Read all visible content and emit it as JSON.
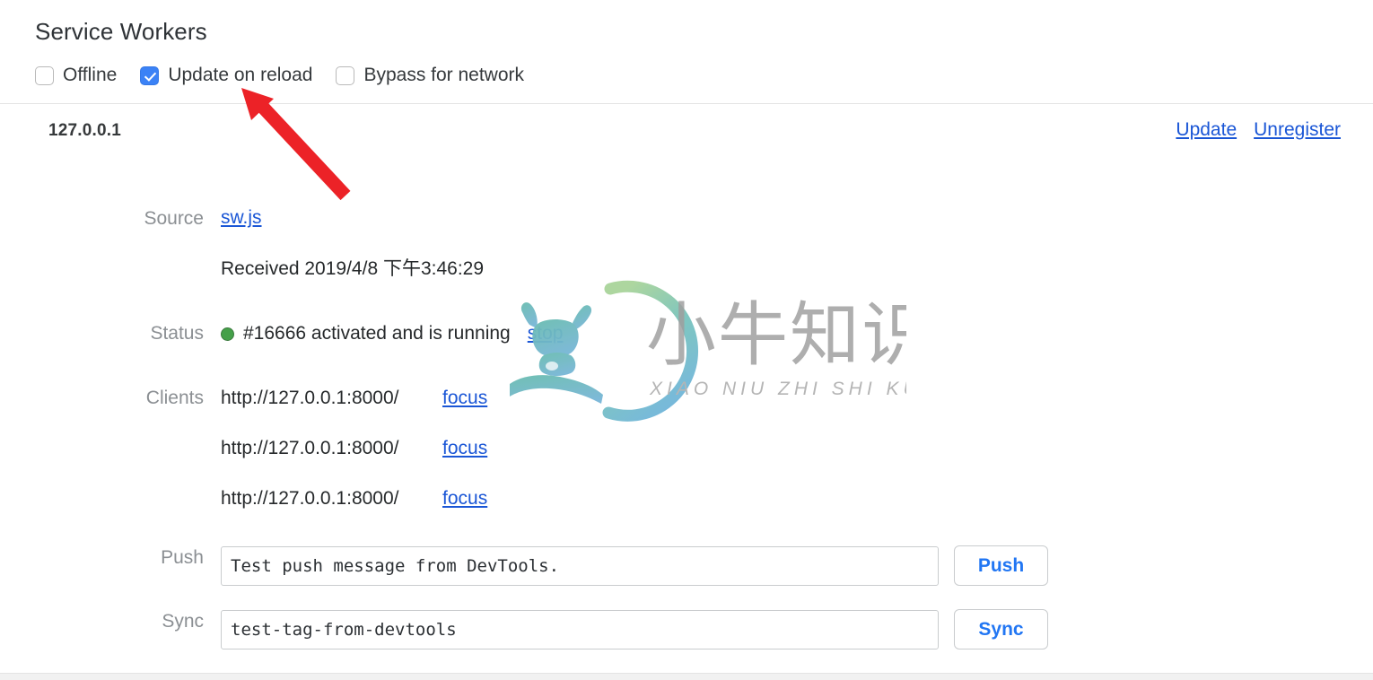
{
  "header": {
    "title": "Service Workers",
    "options": [
      {
        "label": "Offline",
        "checked": false,
        "name": "offline"
      },
      {
        "label": "Update on reload",
        "checked": true,
        "name": "update-on-reload"
      },
      {
        "label": "Bypass for network",
        "checked": false,
        "name": "bypass-for-network"
      }
    ]
  },
  "registration": {
    "origin": "127.0.0.1",
    "actions": {
      "update": "Update",
      "unregister": "Unregister"
    },
    "fields": {
      "source_label": "Source",
      "source_link": "sw.js",
      "received_text": "Received 2019/4/8 下午3:46:29",
      "status_label": "Status",
      "status_text": "#16666 activated and is running",
      "status_color": "#45a049",
      "status_stop_link": "stop",
      "clients_label": "Clients",
      "clients": [
        {
          "url": "http://127.0.0.1:8000/",
          "action": "focus"
        },
        {
          "url": "http://127.0.0.1:8000/",
          "action": "focus"
        },
        {
          "url": "http://127.0.0.1:8000/",
          "action": "focus"
        }
      ],
      "push_label": "Push",
      "push_value": "Test push message from DevTools.",
      "push_button": "Push",
      "sync_label": "Sync",
      "sync_value": "test-tag-from-devtools",
      "sync_button": "Sync"
    }
  },
  "watermark": {
    "text_cn": "小牛知识库",
    "text_pinyin": "XIAO NIU ZHI SHI KU",
    "ring_color_top": "#9ecf8f",
    "ring_color_bottom": "#6aaed6"
  },
  "annotation": {
    "arrow_color": "#ec2227",
    "points_to": "update-on-reload"
  },
  "colors": {
    "link": "#1a56d6",
    "accent_blue": "#3b82f6",
    "button_text": "#2176f3",
    "label_gray": "#8b8f93",
    "title": "#2f3337"
  }
}
